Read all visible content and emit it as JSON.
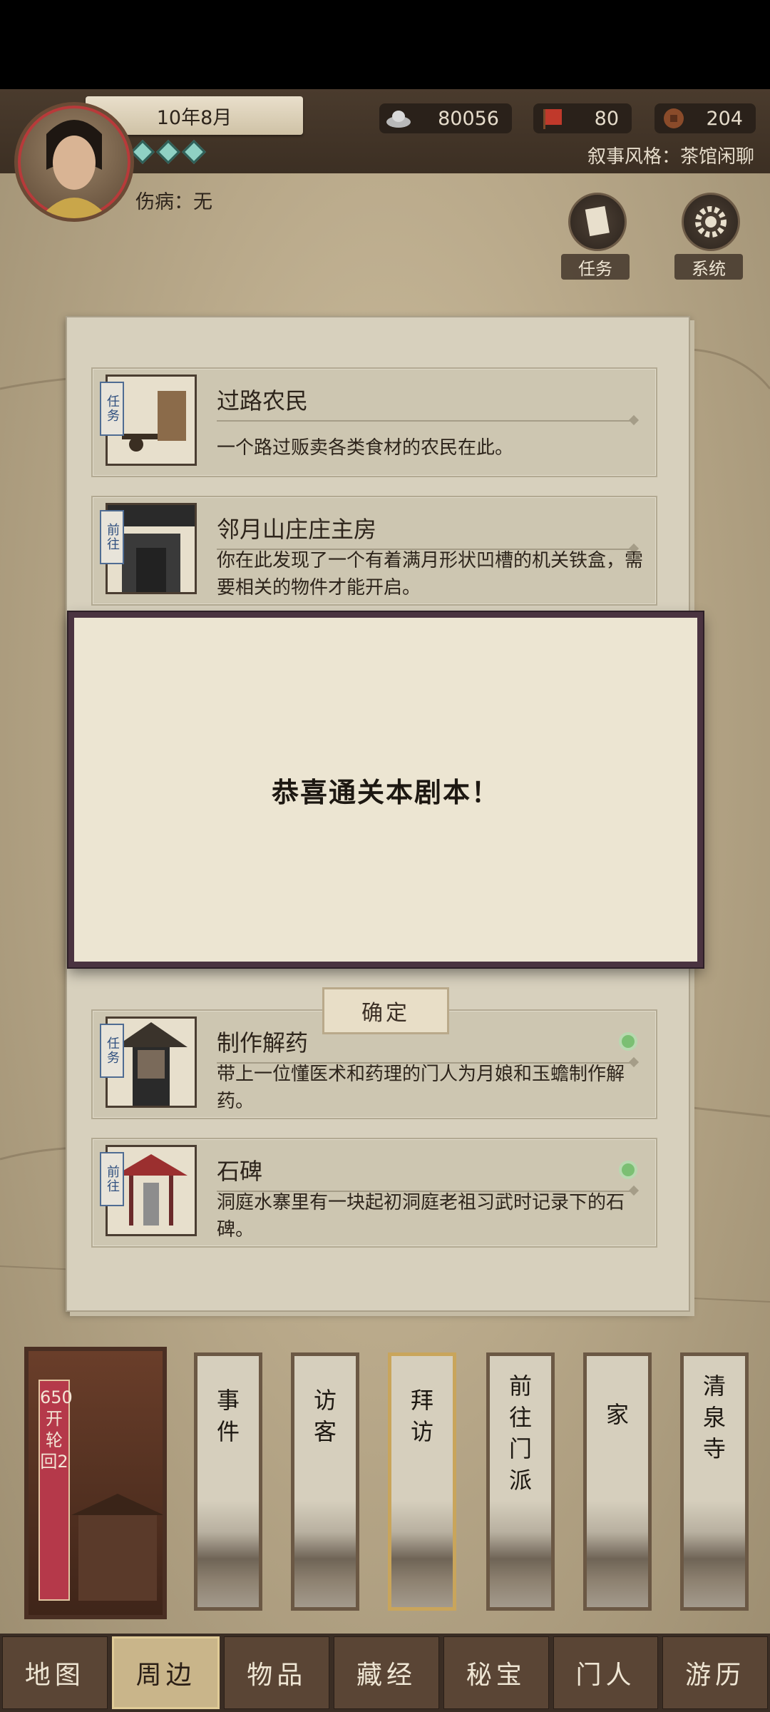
{
  "header": {
    "date": "10年8月",
    "silver": "80056",
    "flag": "80",
    "coin": "204",
    "narrative_style": "叙事风格：茶馆闲聊",
    "injury": "伤病：无",
    "task_label": "任务",
    "system_label": "系统"
  },
  "cards": [
    {
      "tag": "任务",
      "title": "过路农民",
      "desc": "一个路过贩卖各类食材的农民在此。"
    },
    {
      "tag": "前往",
      "title": "邻月山庄庄主房",
      "desc": "你在此发现了一个有着满月形状凹槽的机关铁盒，需要相关的物件才能开启。"
    },
    {
      "tag": "任务",
      "title": "制作解药",
      "desc": "带上一位懂医术和药理的门人为月娘和玉蟾制作解药。"
    },
    {
      "tag": "前往",
      "title": "石碑",
      "desc": "洞庭水寨里有一块起初洞庭老祖习武时记录下的石碑。"
    }
  ],
  "modal": {
    "message": "恭喜通关本剧本！",
    "confirm_label": "确定"
  },
  "round_card": {
    "text": "650开轮回2"
  },
  "locations": [
    "事件",
    "访客",
    "拜访",
    "前往门派",
    "家",
    "清泉寺"
  ],
  "tabs": [
    "地图",
    "周边",
    "物品",
    "藏经",
    "秘宝",
    "门人",
    "游历"
  ],
  "active_tab": "周边"
}
